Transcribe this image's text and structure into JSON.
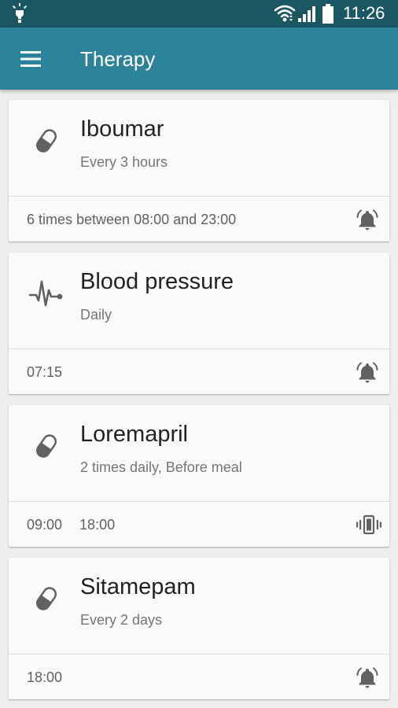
{
  "status_bar": {
    "time": "11:26"
  },
  "app_bar": {
    "title": "Therapy",
    "menu_icon": "menu-icon"
  },
  "colors": {
    "status_bar": "#1b5663",
    "app_bar": "#2c8299",
    "background": "#eeeeee",
    "card": "#fafafa",
    "icon": "#616161"
  },
  "therapies": [
    {
      "name": "Iboumar",
      "schedule": "Every 3 hours",
      "icon": "pill-icon",
      "times": [
        "6 times between 08:00 and 23:00"
      ],
      "alert": "alarm-bell-icon"
    },
    {
      "name": "Blood pressure",
      "schedule": "Daily",
      "icon": "heartbeat-icon",
      "times": [
        "07:15"
      ],
      "alert": "alarm-bell-icon"
    },
    {
      "name": "Loremapril",
      "schedule": "2 times daily, Before meal",
      "icon": "pill-icon",
      "times": [
        "09:00",
        "18:00"
      ],
      "alert": "vibrate-icon"
    },
    {
      "name": "Sitamepam",
      "schedule": "Every 2 days",
      "icon": "pill-icon",
      "times": [
        "18:00"
      ],
      "alert": "alarm-bell-icon"
    }
  ]
}
